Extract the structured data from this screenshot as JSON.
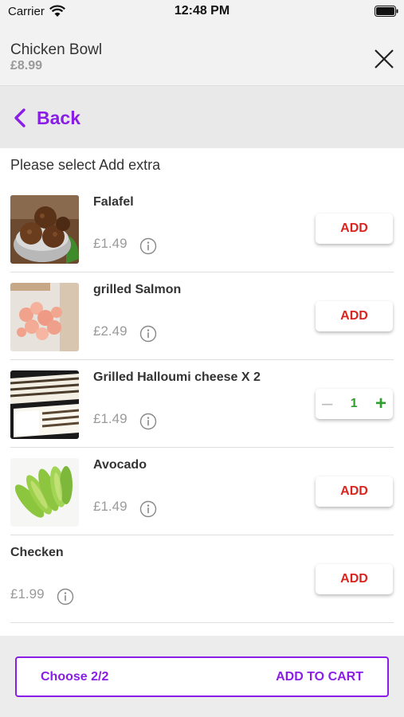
{
  "status_bar": {
    "carrier": "Carrier",
    "time": "12:48 PM"
  },
  "header": {
    "title": "Chicken Bowl",
    "price": "£8.99"
  },
  "nav": {
    "back_label": "Back"
  },
  "section_title": "Please select Add extra",
  "items": [
    {
      "name": "Falafel",
      "price": "£1.49",
      "image": "falafel-image",
      "action": "ADD"
    },
    {
      "name": "grilled Salmon",
      "price": "£2.49",
      "image": "salmon-image",
      "action": "ADD"
    },
    {
      "name": "Grilled Halloumi cheese X 2",
      "price": "£1.49",
      "image": "halloumi-image",
      "quantity": "1"
    },
    {
      "name": "Avocado",
      "price": "£1.49",
      "image": "avocado-image",
      "action": "ADD"
    },
    {
      "name": "Checken",
      "price": "£1.99",
      "action": "ADD"
    }
  ],
  "footer": {
    "choose_label": "Choose 2/2",
    "add_to_cart_label": "ADD TO CART"
  },
  "colors": {
    "accent": "#8a1ee6",
    "add_red": "#d9251f",
    "stepper_green": "#2e9e2e"
  }
}
